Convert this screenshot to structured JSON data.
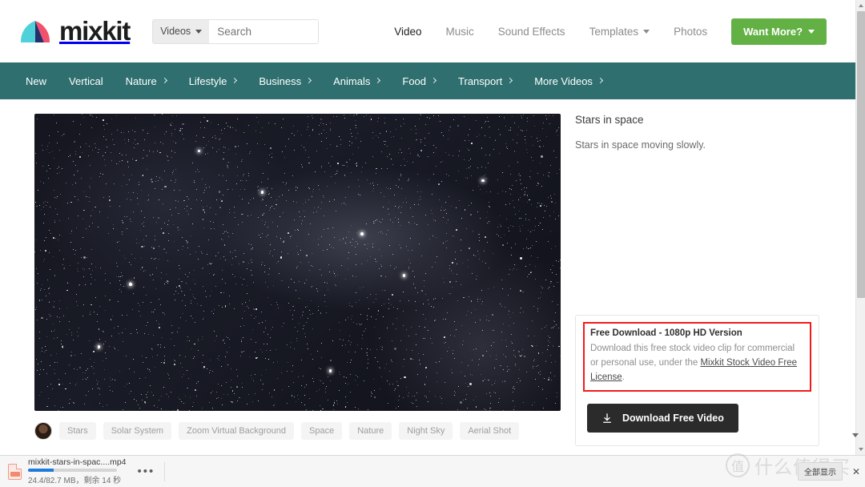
{
  "brand": {
    "name": "mixkit"
  },
  "search": {
    "category": "Videos",
    "placeholder": "Search",
    "value": "",
    "icon": "search-icon"
  },
  "mainnav": {
    "items": [
      {
        "label": "Video",
        "active": true,
        "caret": false
      },
      {
        "label": "Music",
        "active": false,
        "caret": false
      },
      {
        "label": "Sound Effects",
        "active": false,
        "caret": false
      },
      {
        "label": "Templates",
        "active": false,
        "caret": true
      },
      {
        "label": "Photos",
        "active": false,
        "caret": false
      }
    ],
    "cta": "Want More?"
  },
  "catbar": {
    "items": [
      {
        "label": "New",
        "chevron": false
      },
      {
        "label": "Vertical",
        "chevron": false
      },
      {
        "label": "Nature",
        "chevron": true
      },
      {
        "label": "Lifestyle",
        "chevron": true
      },
      {
        "label": "Business",
        "chevron": true
      },
      {
        "label": "Animals",
        "chevron": true
      },
      {
        "label": "Food",
        "chevron": true
      },
      {
        "label": "Transport",
        "chevron": true
      },
      {
        "label": "More Videos",
        "chevron": true
      }
    ],
    "bg": "#2f6f6f"
  },
  "video": {
    "title": "Stars in space",
    "description": "Stars in space moving slowly.",
    "tags": [
      "Stars",
      "Solar System",
      "Zoom Virtual Background",
      "Space",
      "Nature",
      "Night Sky",
      "Aerial Shot"
    ]
  },
  "download_card": {
    "heading": "Free Download - 1080p HD Version",
    "body_before": "Download this free stock video clip for commercial or personal use, under the ",
    "license_link": "Mixkit Stock Video Free License",
    "body_after": ".",
    "button": "Download Free Video",
    "button_icon": "download-icon",
    "highlight_color": "#f21a1a"
  },
  "download_shelf": {
    "file_icon": "mp4-file-icon",
    "filename": "mixkit-stars-in-spac....mp4",
    "progress_percent": 29,
    "status": "24.4/82.7 MB，剩余 14 秒",
    "menu_icon": "more-options-icon",
    "show_all": "全部显示",
    "close_icon": "close-icon"
  },
  "watermark": {
    "badge": "值",
    "text": "什么值得买"
  }
}
